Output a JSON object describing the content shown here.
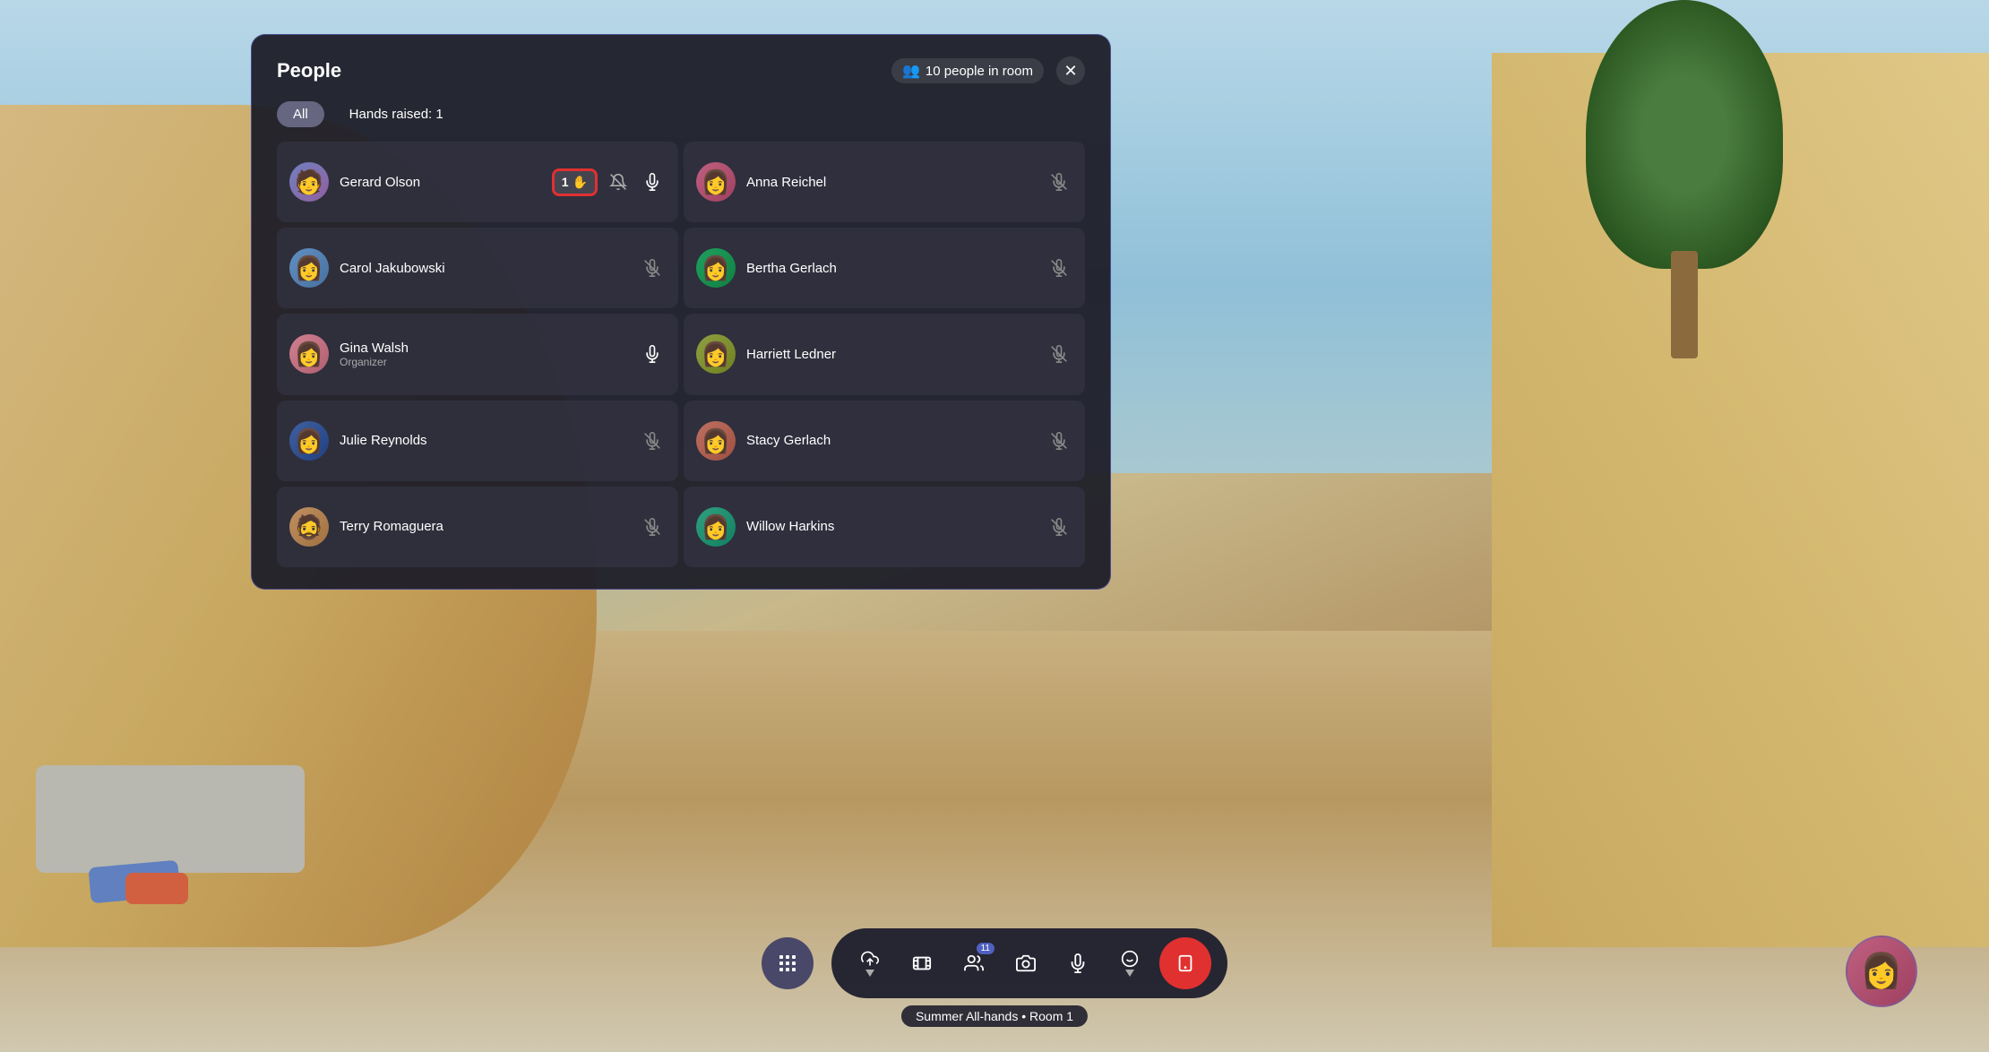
{
  "background": {
    "description": "Virtual VR meeting room background"
  },
  "panel": {
    "title": "People",
    "people_count": "10 people in room",
    "people_icon": "👥",
    "close_label": "✕"
  },
  "filters": {
    "all_label": "All",
    "hands_raised_label": "Hands raised: 1"
  },
  "people": [
    {
      "id": "gerard",
      "name": "Gerard Olson",
      "role": "",
      "avatar_class": "av-gerard",
      "avatar_emoji": "🧑",
      "hand_raised": true,
      "hand_count": "1",
      "mic": "on",
      "column": "left"
    },
    {
      "id": "anna",
      "name": "Anna Reichel",
      "role": "",
      "avatar_class": "av-anna",
      "avatar_emoji": "👩",
      "hand_raised": false,
      "mic": "off",
      "column": "right"
    },
    {
      "id": "carol",
      "name": "Carol Jakubowski",
      "role": "",
      "avatar_class": "av-carol",
      "avatar_emoji": "👩",
      "hand_raised": false,
      "mic": "off",
      "column": "left"
    },
    {
      "id": "bertha",
      "name": "Bertha Gerlach",
      "role": "",
      "avatar_class": "av-bertha",
      "avatar_emoji": "👩",
      "hand_raised": false,
      "mic": "off",
      "column": "right"
    },
    {
      "id": "gina",
      "name": "Gina Walsh",
      "role": "Organizer",
      "avatar_class": "av-gina",
      "avatar_emoji": "👩",
      "hand_raised": false,
      "mic": "on",
      "column": "left"
    },
    {
      "id": "harriett",
      "name": "Harriett Ledner",
      "role": "",
      "avatar_class": "av-harriett",
      "avatar_emoji": "👩",
      "hand_raised": false,
      "mic": "off",
      "column": "right"
    },
    {
      "id": "julie",
      "name": "Julie Reynolds",
      "role": "",
      "avatar_class": "av-julie",
      "avatar_emoji": "👩",
      "hand_raised": false,
      "mic": "off",
      "column": "left"
    },
    {
      "id": "stacy",
      "name": "Stacy Gerlach",
      "role": "",
      "avatar_class": "av-stacy",
      "avatar_emoji": "👩",
      "hand_raised": false,
      "mic": "off",
      "column": "right"
    },
    {
      "id": "terry",
      "name": "Terry Romaguera",
      "role": "",
      "avatar_class": "av-terry",
      "avatar_emoji": "🧔",
      "hand_raised": false,
      "mic": "off",
      "column": "left"
    },
    {
      "id": "willow",
      "name": "Willow Harkins",
      "role": "",
      "avatar_class": "av-willow",
      "avatar_emoji": "👩",
      "hand_raised": false,
      "mic": "off",
      "column": "right"
    }
  ],
  "toolbar": {
    "grid_btn": "⊞",
    "share_btn": "↑",
    "film_btn": "🎬",
    "people_btn": "👤",
    "people_count": "11",
    "camera_btn": "📷",
    "mic_btn": "🎤",
    "emoji_btn": "😊",
    "end_btn": "📱"
  },
  "room_label": "Summer All-hands • Room 1",
  "self_avatar_emoji": "👩"
}
